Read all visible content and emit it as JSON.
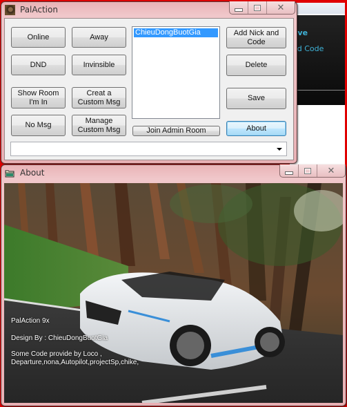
{
  "background_app": {
    "text_1": "ave",
    "text_2": "ed Code"
  },
  "palaction_window": {
    "title": "PalAction",
    "icon": "avatar-icon",
    "caption": {
      "minimize": "minimize-icon",
      "maximize": "maximize-icon",
      "close": "✕"
    },
    "buttons": {
      "online": "Online",
      "away": "Away",
      "dnd": "DND",
      "invisible": "Invinsible",
      "show_room": "Show Room I'm In",
      "create_custom": "Creat a Custom Msg",
      "no_msg": "No Msg",
      "manage_custom": "Manage Custom Msg",
      "join_admin": "Join Admin Room",
      "add_nick": "Add Nick and Code",
      "delete": "Delete",
      "save": "Save",
      "about": "About"
    },
    "nick_list": [
      "ChieuDongBuotGia"
    ],
    "selected_nick": "ChieuDongBuotGia",
    "message_combo": {
      "value": ""
    }
  },
  "about_window": {
    "title": "About",
    "icon": "folder-icon",
    "caption": {
      "minimize": "minimize-icon",
      "maximize": "maximize-icon",
      "close": "✕"
    },
    "lines": {
      "version": "PalAction 9x",
      "design": "Design By : ChieuDongBuotGia",
      "credits_1": "Some Code provide by Loco ,",
      "credits_2": "Departure,nona,Autopilot,projectSp,chike,"
    }
  },
  "colors": {
    "frame_pink": "#e9b3b6",
    "selection": "#3399ff",
    "focus_button": "#bee6fd",
    "desktop_red": "#e00000"
  }
}
